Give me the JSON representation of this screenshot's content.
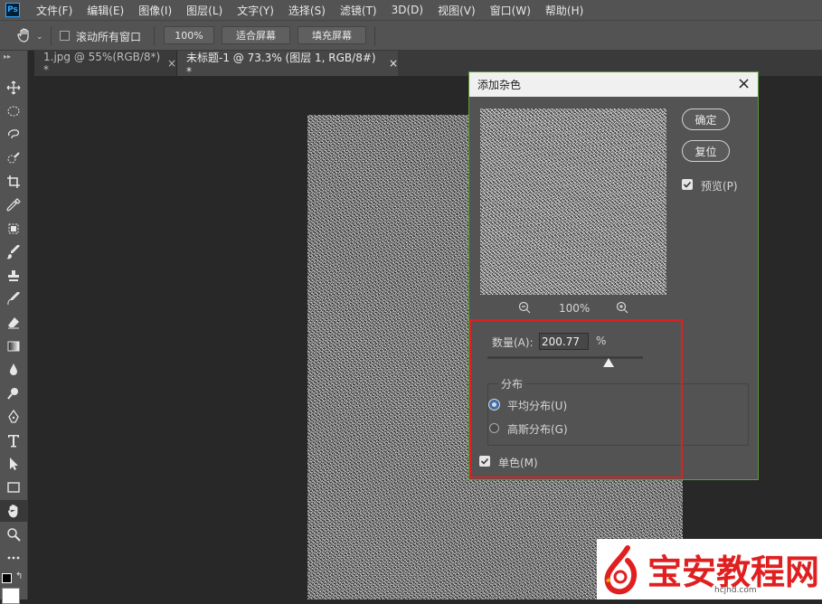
{
  "app": {
    "logo_text": "Ps"
  },
  "menu": [
    "文件(F)",
    "编辑(E)",
    "图像(I)",
    "图层(L)",
    "文字(Y)",
    "选择(S)",
    "滤镜(T)",
    "3D(D)",
    "视图(V)",
    "窗口(W)",
    "帮助(H)"
  ],
  "options": {
    "scroll_all_label": "滚动所有窗口",
    "zoom_btn": "100%",
    "fit_btn": "适合屏幕",
    "fill_btn": "填充屏幕"
  },
  "tabs": [
    {
      "label": "1.jpg @ 55%(RGB/8*) *",
      "close": "×",
      "active": false
    },
    {
      "label": "未标题-1 @ 73.3% (图层 1, RGB/8#) *",
      "close": "×",
      "active": true
    }
  ],
  "dialog": {
    "title": "添加杂色",
    "close": "×",
    "ok": "确定",
    "reset": "复位",
    "preview_label": "预览(P)",
    "preview_checked": true,
    "zoom_level": "100%",
    "amount_label": "数量(A):",
    "amount_value": "200.77",
    "amount_unit": "%",
    "amount_slider_fraction": 0.78,
    "distribution_label": "分布",
    "uniform_label": "平均分布(U)",
    "uniform_selected": true,
    "gaussian_label": "高斯分布(G)",
    "gaussian_selected": false,
    "mono_label": "单色(M)",
    "mono_checked": true
  },
  "watermark": {
    "brand": "宝安教程网",
    "url": "hcjhd.com"
  },
  "colors": {
    "highlight": "#e02020",
    "dialog_border": "#5c9a3b",
    "accent": "#31a8ff"
  }
}
